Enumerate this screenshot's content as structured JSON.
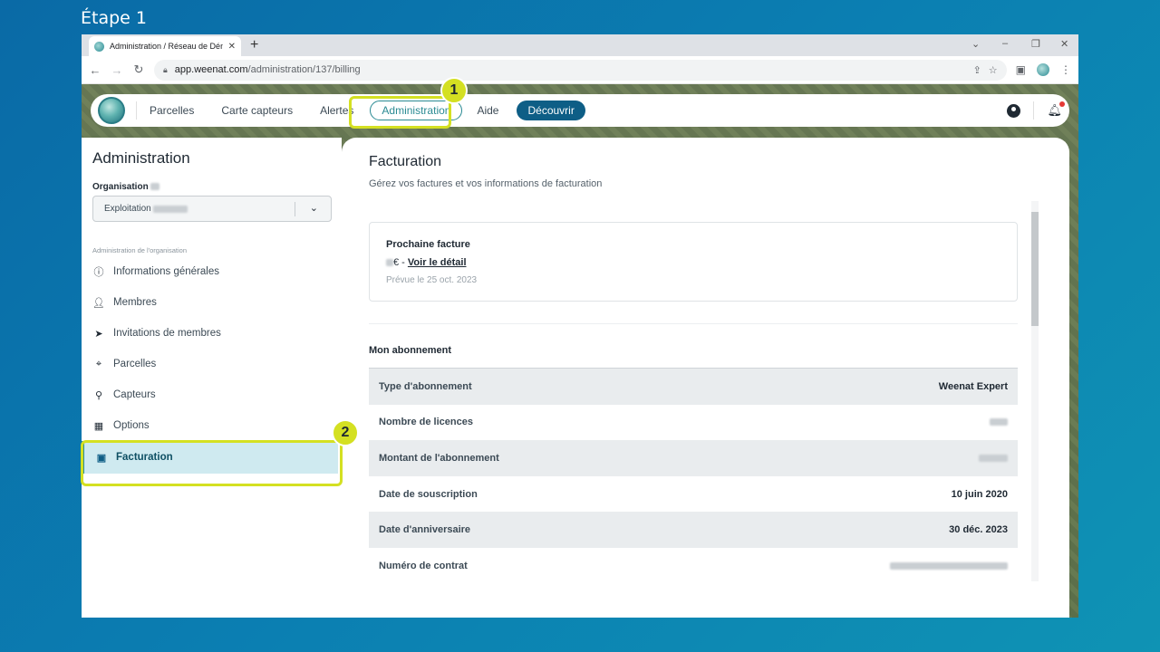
{
  "step_title": "Étape 1",
  "browser": {
    "tab_title": "Administration / Réseau de Dém",
    "url_domain": "app.weenat.com",
    "url_path": "/administration/137/billing"
  },
  "nav": {
    "items": [
      "Parcelles",
      "Carte capteurs",
      "Alertes"
    ],
    "admin": "Administration",
    "help": "Aide",
    "discover": "Découvrir"
  },
  "sidebar": {
    "title": "Administration",
    "org_label": "Organisation",
    "org_value": "Exploitation",
    "section": "Administration de l'organisation",
    "items": [
      {
        "label": "Informations générales",
        "icon": "info-icon"
      },
      {
        "label": "Membres",
        "icon": "person-icon"
      },
      {
        "label": "Invitations de membres",
        "icon": "send-icon"
      },
      {
        "label": "Parcelles",
        "icon": "map-pin-icon"
      },
      {
        "label": "Capteurs",
        "icon": "sensor-icon"
      },
      {
        "label": "Options",
        "icon": "grid-plus-icon"
      }
    ],
    "active": {
      "label": "Facturation",
      "icon": "wallet-icon"
    }
  },
  "main": {
    "title": "Facturation",
    "subtitle": "Gérez vos factures et vos informations de facturation",
    "next_invoice": {
      "heading": "Prochaine facture",
      "currency": "€ -",
      "link": "Voir le détail",
      "due": "Prévue le 25 oct. 2023"
    },
    "subscription": {
      "heading": "Mon abonnement",
      "rows": [
        {
          "label": "Type d'abonnement",
          "value": "Weenat Expert"
        },
        {
          "label": "Nombre de licences",
          "value": ""
        },
        {
          "label": "Montant de l'abonnement",
          "value": ""
        },
        {
          "label": "Date de souscription",
          "value": "10 juin 2020"
        },
        {
          "label": "Date d'anniversaire",
          "value": "30 déc. 2023"
        },
        {
          "label": "Numéro de contrat",
          "value": ""
        }
      ]
    }
  },
  "badges": [
    "1",
    "2"
  ],
  "colors": {
    "highlight": "#d4e022",
    "accent": "#2a8a93",
    "cta": "#0e5e86"
  }
}
